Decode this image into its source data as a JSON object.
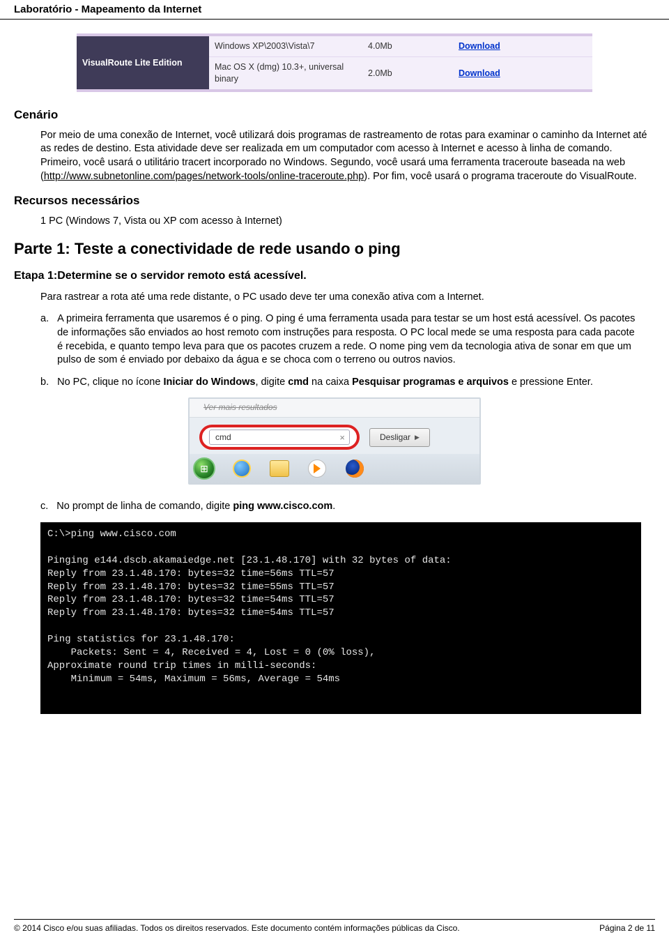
{
  "header": {
    "title": "Laboratório - Mapeamento da Internet"
  },
  "download_table": {
    "product": "VisualRoute Lite Edition",
    "rows": [
      {
        "os": "Windows XP\\2003\\Vista\\7",
        "size": "4.0Mb",
        "link": "Download"
      },
      {
        "os": "Mac OS X (dmg) 10.3+, universal binary",
        "size": "2.0Mb",
        "link": "Download"
      }
    ]
  },
  "scenario": {
    "heading": "Cenário",
    "p1": "Por meio de uma conexão de Internet, você utilizará dois programas de rastreamento de rotas para examinar o caminho da Internet até as redes de destino. Esta atividade deve ser realizada em um computador com acesso à Internet e acesso à linha de comando. Primeiro, você usará o utilitário tracert incorporado no Windows. Segundo, você usará uma ferramenta traceroute baseada na web (",
    "link": "http://www.subnetonline.com/pages/network-tools/online-traceroute.php",
    "p1_after": "). Por fim, você usará o programa traceroute do VisualRoute."
  },
  "resources": {
    "heading": "Recursos necessários",
    "item": "1 PC (Windows 7, Vista ou XP com acesso à Internet)"
  },
  "part1": {
    "heading": "Parte 1: Teste a conectividade de rede usando o ping",
    "step1_heading": "Etapa 1:Determine se o servidor remoto está acessível.",
    "intro": "Para rastrear a rota até uma rede distante, o PC usado deve ter uma conexão ativa com a Internet.",
    "a_marker": "a.",
    "a_text": "A primeira ferramenta que usaremos é o ping. O ping é uma ferramenta usada para testar se um host está acessível. Os pacotes de informações são enviados ao host remoto com instruções para resposta. O PC local mede se uma resposta para cada pacote é recebida, e quanto tempo leva para que os pacotes cruzem a rede. O nome ping vem da tecnologia ativa de sonar em que um pulso de som é enviado por debaixo da água e se choca com o terreno ou outros navios.",
    "b_marker": "b.",
    "b_text_pre": "No PC, clique no ícone ",
    "b_bold1": "Iniciar do Windows",
    "b_mid1": ", digite ",
    "b_bold2": "cmd",
    "b_mid2": " na caixa ",
    "b_bold3": "Pesquisar programas e arquivos",
    "b_post": " e pressione Enter.",
    "win_top_hint": "Ver mais resultados",
    "win_cmd_value": "cmd",
    "win_desligar": "Desligar",
    "c_marker": "c.",
    "c_text_pre": "No prompt de linha de comando, digite ",
    "c_bold": "ping www.cisco.com",
    "c_post": "."
  },
  "terminal": {
    "lines": [
      "C:\\>ping www.cisco.com",
      "",
      "Pinging e144.dscb.akamaiedge.net [23.1.48.170] with 32 bytes of data:",
      "Reply from 23.1.48.170: bytes=32 time=56ms TTL=57",
      "Reply from 23.1.48.170: bytes=32 time=55ms TTL=57",
      "Reply from 23.1.48.170: bytes=32 time=54ms TTL=57",
      "Reply from 23.1.48.170: bytes=32 time=54ms TTL=57",
      "",
      "Ping statistics for 23.1.48.170:",
      "    Packets: Sent = 4, Received = 4, Lost = 0 (0% loss),",
      "Approximate round trip times in milli-seconds:",
      "    Minimum = 54ms, Maximum = 56ms, Average = 54ms"
    ]
  },
  "footer": {
    "left": "© 2014 Cisco e/ou suas afiliadas. Todos os direitos reservados. Este documento contém informações públicas da Cisco.",
    "right": "Página 2 de 11"
  }
}
